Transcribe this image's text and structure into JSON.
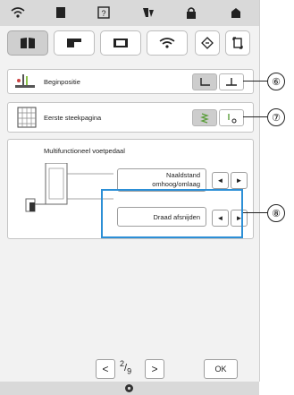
{
  "topbar": {
    "icons": [
      "wifi-icon",
      "page-icon",
      "help-icon",
      "sewing-icon",
      "lock-icon",
      "home-icon"
    ]
  },
  "tabs": [
    {
      "name": "tab-machine-settings",
      "icon": "book-icon",
      "active": true
    },
    {
      "name": "tab-sewing-machine",
      "icon": "machine-icon",
      "active": false
    },
    {
      "name": "tab-display",
      "icon": "screen-icon",
      "active": false
    },
    {
      "name": "tab-wireless",
      "icon": "wifi-icon",
      "active": false
    }
  ],
  "rows": {
    "start_position": {
      "label": "Beginpositie"
    },
    "first_stitch_page": {
      "label": "Eerste steekpagina"
    }
  },
  "pedal": {
    "title": "Multifunctioneel voetpedaal",
    "needle_line1": "Naaldstand",
    "needle_line2": "omhoog/omlaag",
    "cut_label": "Draad afsnijden",
    "left_arrow": "◄",
    "right_arrow": "►"
  },
  "pager": {
    "prev": "<",
    "current": "2",
    "total": "9",
    "next": ">",
    "ok_label": "OK"
  },
  "callouts": [
    "⑥",
    "⑦",
    "⑧"
  ],
  "colors": {
    "highlight": "#2c8fd6",
    "panel": "#ffffff",
    "background": "#f2f2f2"
  }
}
